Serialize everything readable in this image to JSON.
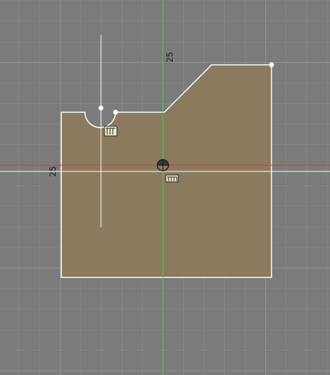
{
  "sketch": {
    "dimensions": [
      {
        "name": "vertical-grid-dimension",
        "value": "25"
      },
      {
        "name": "horizontal-grid-dimension",
        "value": "25"
      }
    ]
  },
  "colors": {
    "background": "#7b7b7b",
    "grid_minor": "#8a8a8a",
    "grid_major": "#939393",
    "profile_fill": "#8c7a5d",
    "profile_stroke": "#ffffff",
    "axis_x": "#e03030",
    "axis_y": "#4cd04c",
    "construction_line": "#ffffff"
  },
  "icons": {
    "origin": "origin-icon",
    "fix_constraint": "fix-constraint-icon",
    "horizontal_constraint": "horizontal-constraint-icon"
  }
}
